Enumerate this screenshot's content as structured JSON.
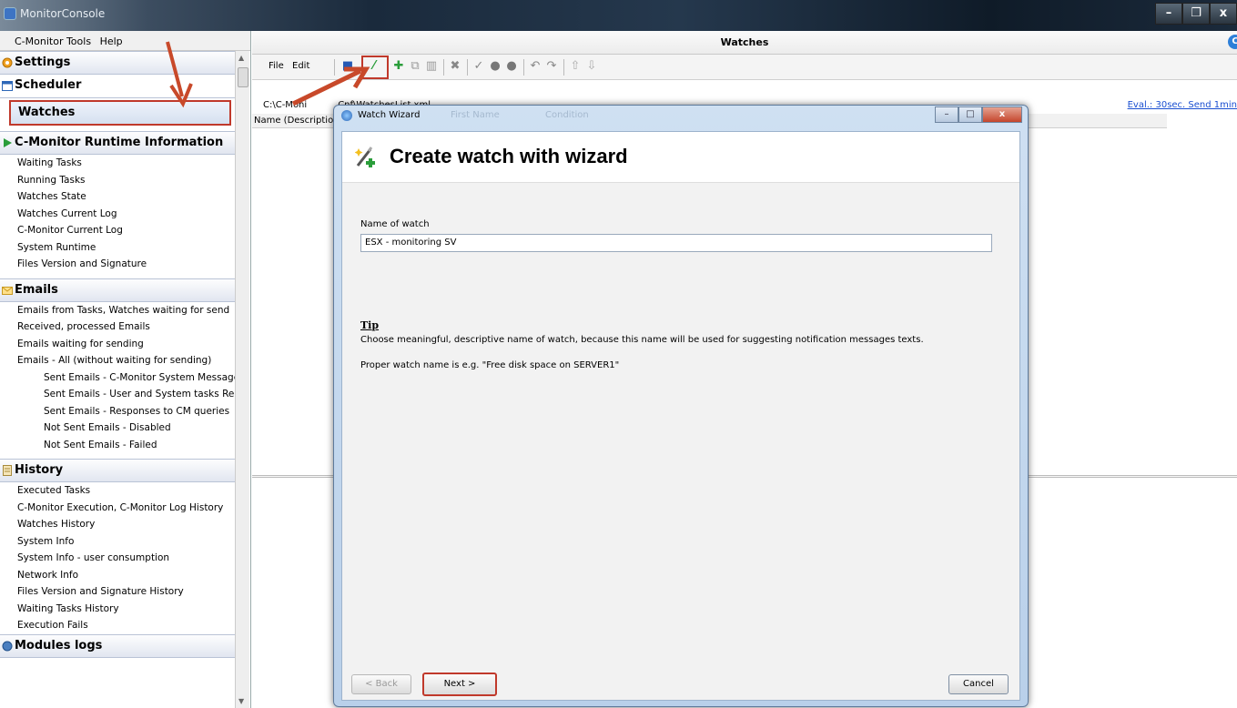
{
  "app": {
    "title": "MonitorConsole",
    "window_controls": [
      "–",
      "❐",
      "x"
    ]
  },
  "menu": {
    "items": [
      "C-Monitor Tools",
      "Help"
    ]
  },
  "sidebar": {
    "settings": "Settings",
    "scheduler": "Scheduler",
    "watches": "Watches",
    "runtime": {
      "header": "C-Monitor Runtime Information",
      "items": [
        "Waiting Tasks",
        "Running Tasks",
        "Watches State",
        "Watches Current Log",
        "C-Monitor Current Log",
        "System Runtime",
        "Files Version and Signature"
      ]
    },
    "emails": {
      "header": "Emails",
      "items": [
        "Emails from Tasks, Watches waiting for send",
        "Received, processed Emails",
        "Emails waiting for sending",
        "Emails - All (without waiting for sending)"
      ],
      "sub_items": [
        "Sent Emails - C-Monitor System Message",
        "Sent Emails - User and System tasks Rec",
        "Sent Emails - Responses to CM queries",
        "Not Sent Emails - Disabled",
        "Not Sent Emails - Failed"
      ]
    },
    "history": {
      "header": "History",
      "items": [
        "Executed Tasks",
        "C-Monitor Execution, C-Monitor Log History",
        "Watches History",
        "System Info",
        "System Info - user consumption",
        "Network Info",
        "Files Version and Signature History",
        "Waiting Tasks History",
        "Execution Fails"
      ]
    },
    "modules": "Modules logs"
  },
  "main": {
    "title": "Watches",
    "help_icon": "C",
    "toolbar": {
      "file": "File",
      "edit": "Edit"
    },
    "path": "C:\\C-Monitor\\Cnf\\WatchesList.xml",
    "path_visible": "C:\\C-Moni",
    "path_tail": "Cnf\\WatchesList.xml",
    "eval_link": "Eval.: 30sec. Send 1min",
    "column_header": "Name (Descriptio"
  },
  "dialog": {
    "title": "Watch Wizard",
    "ghost_columns": [
      "First Name",
      "Condition"
    ],
    "heading": "Create watch with wizard",
    "name_label": "Name of watch",
    "name_value": "ESX - monitoring SV",
    "tip_heading": "Tip",
    "tip_text": "Choose meaningful, descriptive name of watch, because this name will be used for suggesting notification messages texts.",
    "tip_example": "Proper watch name is e.g. \"Free disk space on SERVER1\"",
    "back_label": "< Back",
    "next_label": "Next >",
    "cancel_label": "Cancel"
  },
  "colors": {
    "highlight": "#c0392b",
    "link": "#1a4fd1",
    "accent": "#2e7fd8"
  }
}
